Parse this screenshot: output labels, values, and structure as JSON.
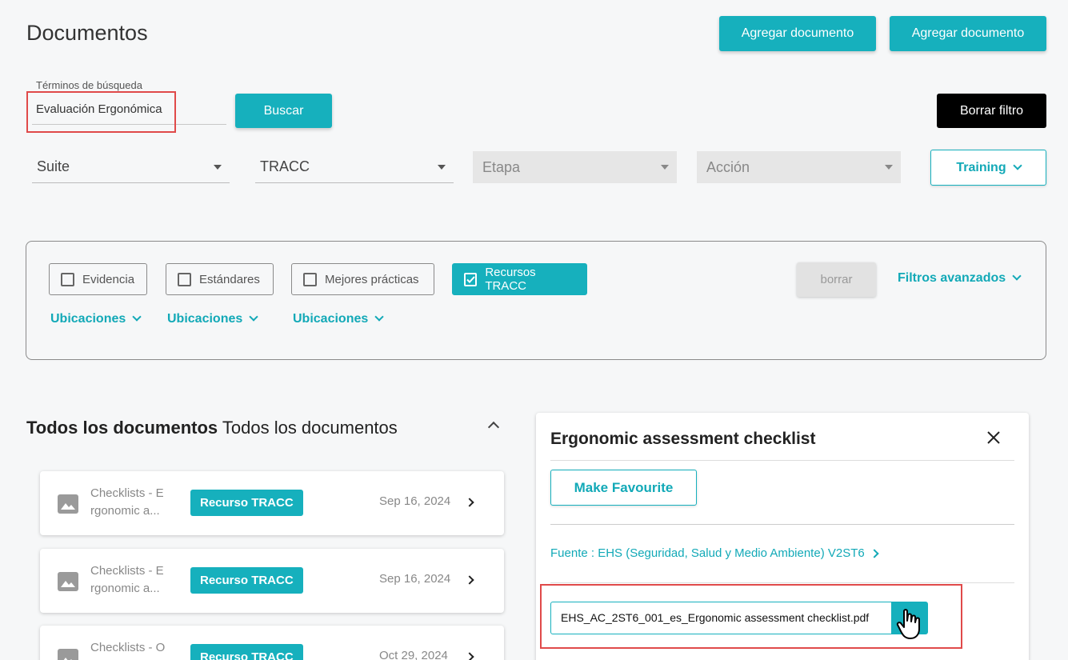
{
  "header": {
    "title": "Documentos",
    "add_doc_1": "Agregar documento",
    "add_doc_2": "Agregar documento"
  },
  "search": {
    "label": "Términos de búsqueda",
    "value": "Evaluación Ergonómica",
    "button": "Buscar",
    "clear_filter": "Borrar filtro"
  },
  "selects": {
    "suite": "Suite",
    "tracc": "TRACC",
    "etapa": "Etapa",
    "accion": "Acción",
    "training": "Training"
  },
  "filters": {
    "chips": [
      {
        "label": "Evidencia",
        "checked": false
      },
      {
        "label": "Estándares",
        "checked": false
      },
      {
        "label": "Mejores prácticas",
        "checked": false
      },
      {
        "label": "Recursos TRACC",
        "checked": true
      }
    ],
    "clear": "borrar",
    "advanced": "Filtros avanzados",
    "locations": [
      "Ubicaciones",
      "Ubicaciones",
      "Ubicaciones"
    ]
  },
  "list": {
    "title_bold": "Todos los documentos",
    "title_normal": "Todos los documentos",
    "items": [
      {
        "name_l1": "Checklists - E",
        "name_l2": "rgonomic a...",
        "badge": "Recurso TRACC",
        "date": "Sep 16, 2024"
      },
      {
        "name_l1": "Checklists - E",
        "name_l2": "rgonomic a...",
        "badge": "Recurso TRACC",
        "date": "Sep 16, 2024"
      },
      {
        "name_l1": "Checklists - O",
        "name_l2": "",
        "badge": "Recurso TRACC",
        "date": "Oct 29, 2024"
      }
    ]
  },
  "detail": {
    "title": "Ergonomic assessment checklist",
    "favourite": "Make Favourite",
    "source": "Fuente : EHS (Seguridad, Salud y Medio Ambiente) V2ST6",
    "file_name": "EHS_AC_2ST6_001_es_Ergonomic assessment checklist.pdf"
  },
  "colors": {
    "accent": "#16b0bd",
    "highlight": "#e04a4a",
    "dark_button": "#000000"
  }
}
